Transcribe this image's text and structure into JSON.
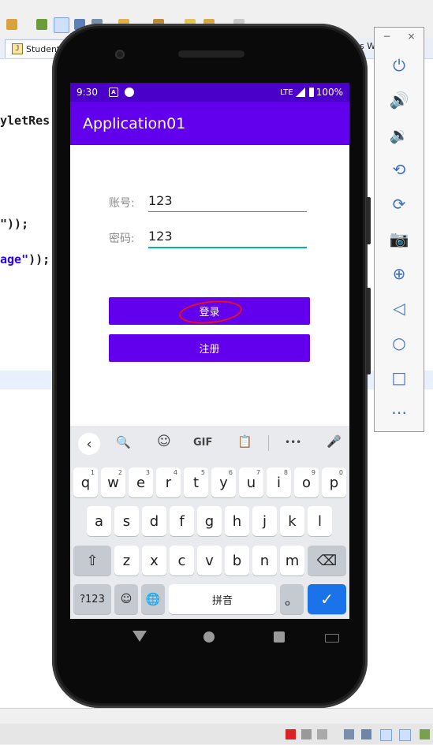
{
  "ide": {
    "tab_label": "Student",
    "tab_right_fragment": "s W",
    "code_lines": [
      {
        "text": "yletRes",
        "kw": ""
      },
      {
        "text": "\"));",
        "kw": ""
      },
      {
        "text": "age\"));",
        "kw": "age\""
      }
    ]
  },
  "emulator_panel": {
    "window_controls": [
      "−",
      "×"
    ],
    "buttons": [
      {
        "name": "power-icon",
        "glyph": "⏻"
      },
      {
        "name": "volume-up-icon",
        "glyph": "🔊"
      },
      {
        "name": "volume-down-icon",
        "glyph": "🔉"
      },
      {
        "name": "rotate-left-icon",
        "glyph": "⟲"
      },
      {
        "name": "rotate-right-icon",
        "glyph": "⟳"
      },
      {
        "name": "camera-icon",
        "glyph": "📷"
      },
      {
        "name": "zoom-icon",
        "glyph": "⊕"
      },
      {
        "name": "back-icon",
        "glyph": "◁"
      },
      {
        "name": "home-icon",
        "glyph": "○"
      },
      {
        "name": "overview-icon",
        "glyph": "□"
      },
      {
        "name": "more-icon",
        "glyph": "⋯"
      }
    ]
  },
  "status": {
    "time": "9:30",
    "network": "LTE",
    "battery": "100%"
  },
  "app": {
    "title": "Application01",
    "account_label": "账号:",
    "account_value": "123",
    "password_label": "密码:",
    "password_value": "123",
    "login_button": "登录",
    "register_button": "注册"
  },
  "keyboard": {
    "toolbar": [
      "‹",
      "🔍",
      "☺",
      "GIF",
      "📋",
      "•••",
      "🎤"
    ],
    "row1": [
      [
        "q",
        "1"
      ],
      [
        "w",
        "2"
      ],
      [
        "e",
        "3"
      ],
      [
        "r",
        "4"
      ],
      [
        "t",
        "5"
      ],
      [
        "y",
        "6"
      ],
      [
        "u",
        "7"
      ],
      [
        "i",
        "8"
      ],
      [
        "o",
        "9"
      ],
      [
        "p",
        "0"
      ]
    ],
    "row2": [
      "a",
      "s",
      "d",
      "f",
      "g",
      "h",
      "j",
      "k",
      "l"
    ],
    "row3": [
      "z",
      "x",
      "c",
      "v",
      "b",
      "n",
      "m"
    ],
    "symbols_key": "?123",
    "space_label": "拼音",
    "period_key": "。",
    "enter_glyph": "✓",
    "shift_glyph": "⇧",
    "backspace_glyph": "⌫",
    "emoji_glyph": "☺",
    "globe_glyph": "🌐"
  }
}
